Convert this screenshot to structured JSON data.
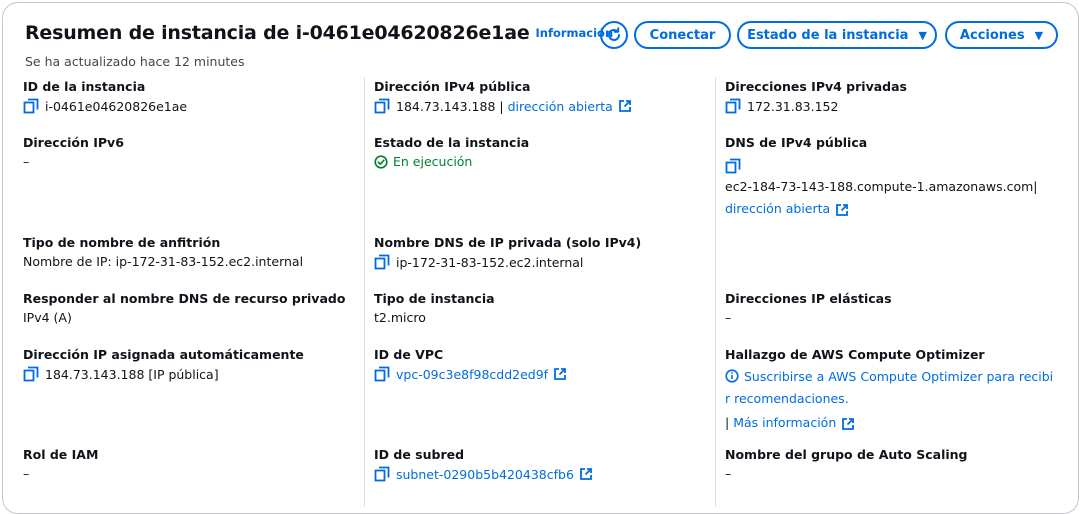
{
  "header": {
    "title": "Resumen de instancia de i-0461e04620826e1ae",
    "info_link": "Información",
    "updated": "Se ha actualizado hace 12 minutes",
    "connect_label": "Conectar",
    "instance_state_label": "Estado de la instancia",
    "actions_label": "Acciones"
  },
  "fields": {
    "instance_id": {
      "label": "ID de la instancia",
      "value": "i-0461e04620826e1ae"
    },
    "public_ipv4": {
      "label": "Dirección IPv4 pública",
      "value": "184.73.143.188",
      "sep": "|",
      "link": "dirección abierta"
    },
    "private_ipv4": {
      "label": "Direcciones IPv4 privadas",
      "value": "172.31.83.152"
    },
    "ipv6": {
      "label": "Dirección IPv6",
      "value": "–"
    },
    "instance_state": {
      "label": "Estado de la instancia",
      "value": "En ejecución"
    },
    "public_dns": {
      "label": "DNS de IPv4 pública",
      "value": "ec2-184-73-143-188.compute-1.amazonaws.com",
      "sep": "|",
      "link": "dirección abierta"
    },
    "hostname_type": {
      "label": "Tipo de nombre de anfitrión",
      "value": "Nombre de IP: ip-172-31-83-152.ec2.internal"
    },
    "private_dns": {
      "label": "Nombre DNS de IP privada (solo IPv4)",
      "value": "ip-172-31-83-152.ec2.internal"
    },
    "resource_dns": {
      "label": "Responder al nombre DNS de recurso privado",
      "value": "IPv4 (A)"
    },
    "instance_type": {
      "label": "Tipo de instancia",
      "value": "t2.micro"
    },
    "elastic_ip": {
      "label": "Direcciones IP elásticas",
      "value": "–"
    },
    "auto_ip": {
      "label": "Dirección IP asignada automáticamente",
      "value": "184.73.143.188 [IP pública]"
    },
    "vpc_id": {
      "label": "ID de VPC",
      "value": "vpc-09c3e8f98cdd2ed9f"
    },
    "optimizer": {
      "label": "Hallazgo de AWS Compute Optimizer",
      "line1": "Suscribirse a AWS Compute Optimizer para recibi",
      "line2": "r recomendaciones.",
      "sep": "|",
      "more": "Más información"
    },
    "iam_role": {
      "label": "Rol de IAM",
      "value": "–"
    },
    "subnet_id": {
      "label": "ID de subred",
      "value": "subnet-0290b5b420438cfb6"
    },
    "asg_name": {
      "label": "Nombre del grupo de Auto Scaling",
      "value": "–"
    }
  },
  "colors": {
    "link": "#006ce0",
    "success": "#00802f",
    "text": "#0f141a",
    "muted": "#424650",
    "border": "#c6c6cd"
  },
  "icons": [
    "refresh-icon",
    "caret-down-icon",
    "copy-icon",
    "external-link-icon",
    "check-circle-icon",
    "info-icon"
  ]
}
